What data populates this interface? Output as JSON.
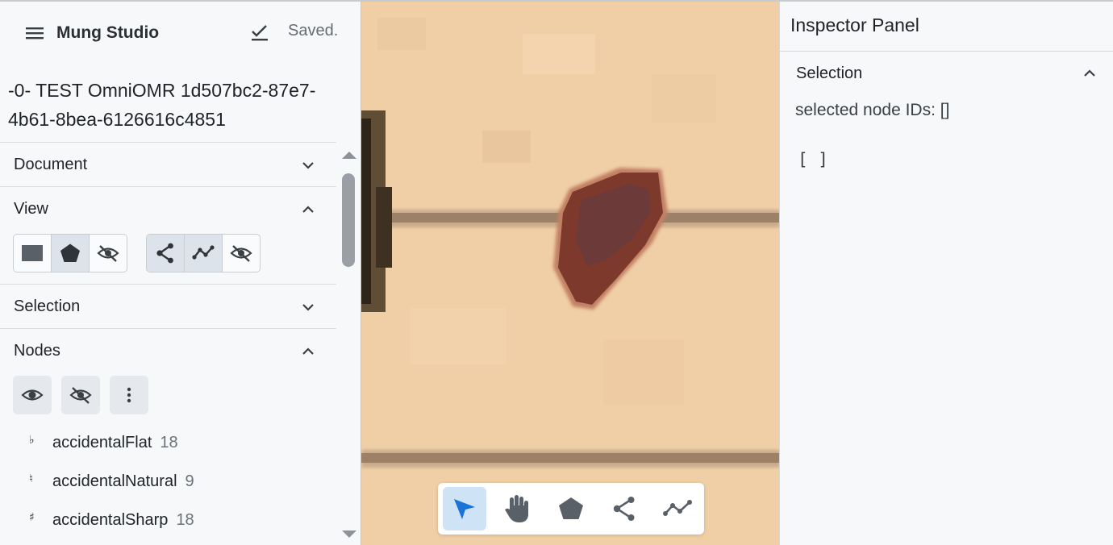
{
  "app": {
    "title": "Mung Studio",
    "save_status": "Saved."
  },
  "document": {
    "title": "-0- TEST OmniOMR 1d507bc2-87e7-4b61-8bea-6126616c4851"
  },
  "sections": {
    "document": {
      "label": "Document",
      "expanded": false
    },
    "view": {
      "label": "View",
      "expanded": true
    },
    "selection": {
      "label": "Selection",
      "expanded": false
    },
    "nodes": {
      "label": "Nodes",
      "expanded": true
    }
  },
  "view_controls": {
    "node_display": [
      "filled-rectangle-icon",
      "polygon-icon",
      "eye-off-icon"
    ],
    "node_display_active": "polygon-icon",
    "edge_display": [
      "graph-edges-icon",
      "polyline-icon",
      "eye-off-icon"
    ],
    "edge_display_active": [
      "graph-edges-icon",
      "polyline-icon"
    ]
  },
  "node_actions": [
    "eye-icon",
    "eye-off-icon",
    "more-vertical-icon"
  ],
  "nodes": [
    {
      "symbol": "♭",
      "name": "accidentalFlat",
      "count": "18"
    },
    {
      "symbol": "♮",
      "name": "accidentalNatural",
      "count": "9"
    },
    {
      "symbol": "♯",
      "name": "accidentalSharp",
      "count": "18"
    }
  ],
  "tools": [
    "pointer-icon",
    "hand-icon",
    "polygon-icon",
    "graph-edges-icon",
    "polyline-icon"
  ],
  "active_tool": "pointer-icon",
  "inspector": {
    "title": "Inspector Panel",
    "section_label": "Selection",
    "selected_ids_text": "selected node IDs: []",
    "selection_json": "[ ]"
  },
  "colors": {
    "accent": "#1a73d9",
    "active_tool_bg": "#cfe3f7",
    "active_toggle_bg": "#dde3ea",
    "panel_bg": "#f7f8fa",
    "icon": "#3a3f44"
  }
}
